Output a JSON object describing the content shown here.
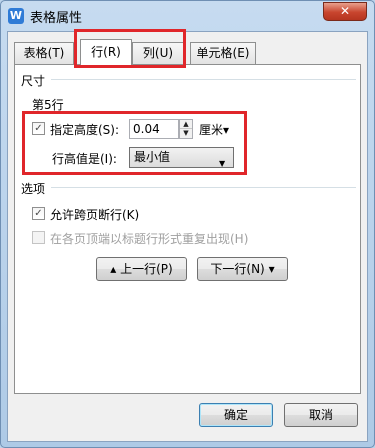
{
  "window": {
    "title": "表格属性",
    "app_icon": "W",
    "close_glyph": "✕"
  },
  "tabs": [
    {
      "label": "表格(T)"
    },
    {
      "label": "行(R)"
    },
    {
      "label": "列(U)"
    },
    {
      "label": "单元格(E)"
    }
  ],
  "size_group": {
    "title": "尺寸",
    "row_label": "第5行",
    "height_checkbox": {
      "label": "指定高度(S):",
      "checked": true,
      "glyph": "✓"
    },
    "height_value": "0.04",
    "unit": "厘米",
    "row_height_is_label": "行高值是(I):",
    "row_height_is_value": "最小值"
  },
  "options_group": {
    "title": "选项",
    "allow_break": {
      "label": "允许跨页断行(K)",
      "checked": true,
      "glyph": "✓"
    },
    "repeat_header": {
      "label": "在各页顶端以标题行形式重复出现(H)",
      "checked": false,
      "disabled": true
    }
  },
  "nav": {
    "prev_label": "上一行(P)",
    "next_label": "下一行(N)"
  },
  "footer": {
    "ok_label": "确定",
    "cancel_label": "取消"
  },
  "icons": {
    "spin_up": "▲",
    "spin_down": "▼",
    "dropdown": "▾",
    "prev_arrow": "▴",
    "next_arrow": "▾"
  },
  "colors": {
    "highlight": "#e0262a"
  }
}
